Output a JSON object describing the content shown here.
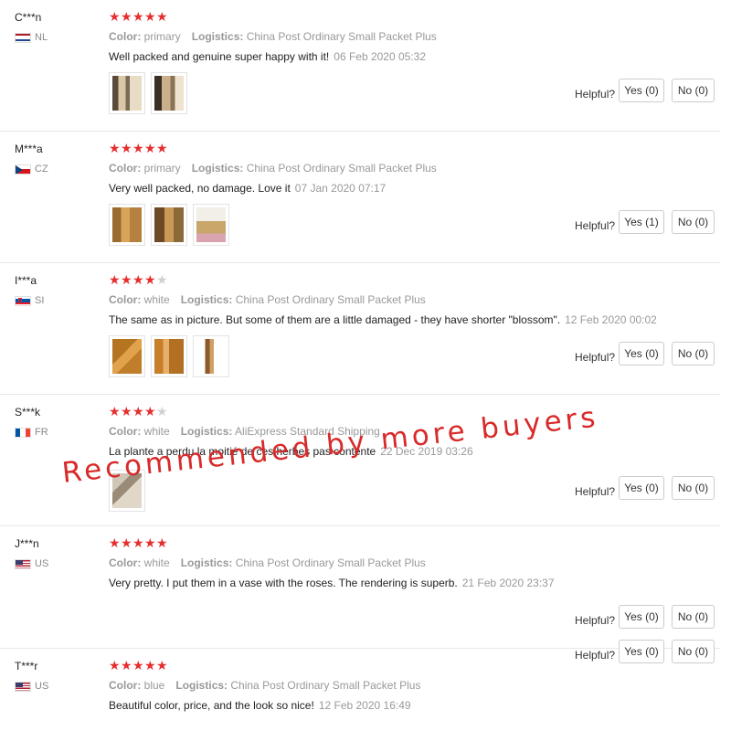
{
  "labels": {
    "color": "Color:",
    "logistics": "Logistics:",
    "helpful": "Helpful?"
  },
  "reviews": [
    {
      "user": "C***n",
      "country": "NL",
      "flag": "nl",
      "stars": 5,
      "color": "primary",
      "logistics": "China Post Ordinary Small Packet Plus",
      "text": "Well packed and genuine super happy with it!",
      "date": "06 Feb 2020 05:32",
      "photos": 2,
      "yes": "Yes (0)",
      "no": "No (0)"
    },
    {
      "user": "M***a",
      "country": "CZ",
      "flag": "cz",
      "stars": 5,
      "color": "primary",
      "logistics": "China Post Ordinary Small Packet Plus",
      "text": "Very well packed, no damage. Love it",
      "date": "07 Jan 2020 07:17",
      "photos": 3,
      "yes": "Yes (1)",
      "no": "No (0)"
    },
    {
      "user": "I***a",
      "country": "SI",
      "flag": "si",
      "stars": 4,
      "color": "white",
      "logistics": "China Post Ordinary Small Packet Plus",
      "text": "The same as in picture. But some of them are a little damaged - they have shorter \"blossom\".",
      "date": "12 Feb 2020 00:02",
      "photos": 3,
      "yes": "Yes (0)",
      "no": "No (0)"
    },
    {
      "user": "S***k",
      "country": "FR",
      "flag": "fr",
      "stars": 4,
      "color": "white",
      "logistics": "AliExpress Standard Shipping",
      "text": "La plante a perdu la moitié de ces herbes pas contente",
      "date": "22 Dec 2019 03:26",
      "photos": 1,
      "yes": "Yes (0)",
      "no": "No (0)"
    },
    {
      "user": "J***n",
      "country": "US",
      "flag": "us",
      "stars": 5,
      "color": "white",
      "logistics": "China Post Ordinary Small Packet Plus",
      "text": "Very pretty. I put them in a vase with the roses. The rendering is superb.",
      "date": "21 Feb 2020 23:37",
      "photos": 0,
      "yes": "Yes (0)",
      "no": "No (0)"
    },
    {
      "user": "T***r",
      "country": "US",
      "flag": "us",
      "stars": 5,
      "color": "blue",
      "logistics": "China Post Ordinary Small Packet Plus",
      "text": "Beautiful color, price, and the look so nice!",
      "date": "12 Feb 2020 16:49",
      "photos": 0,
      "yes": "Yes (0)",
      "no": "No (0)"
    }
  ],
  "overlay_text": "Recommended by more buyers",
  "colors": {
    "star": "#e62e2e",
    "star_off": "#d0d0d0",
    "overlay": "#d82a2a"
  }
}
